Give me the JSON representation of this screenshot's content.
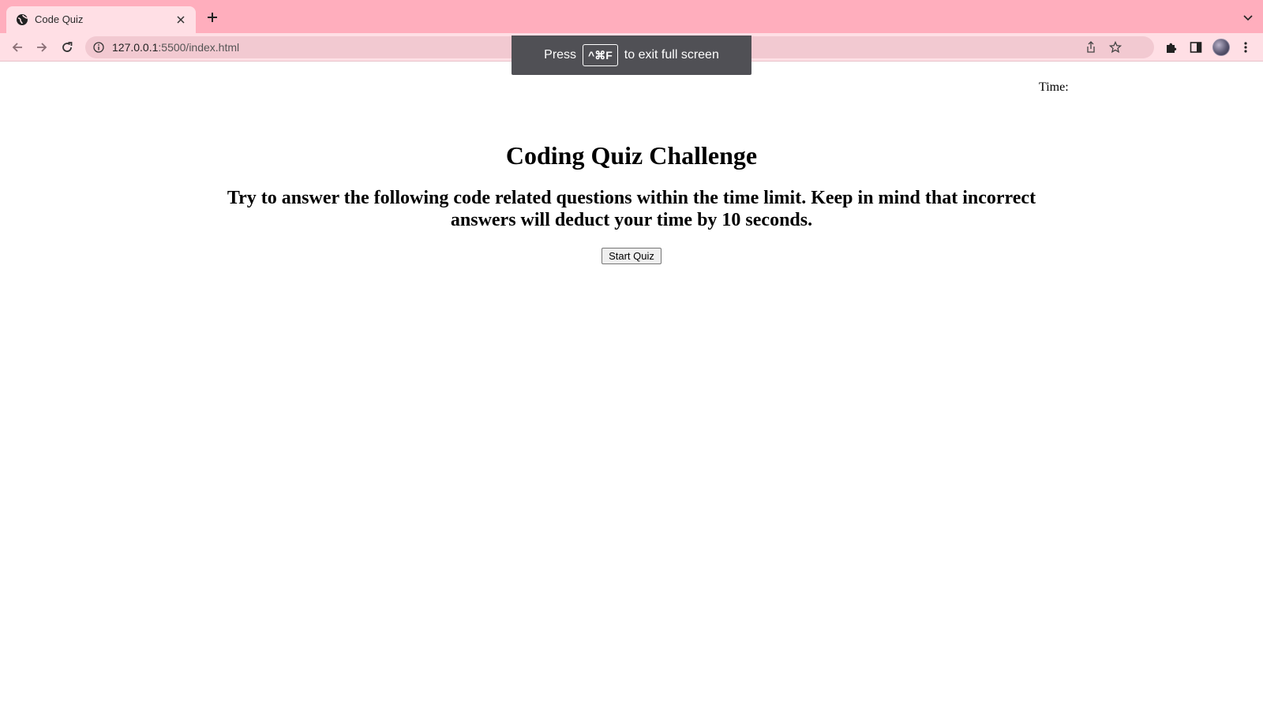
{
  "browser": {
    "tab": {
      "title": "Code Quiz"
    },
    "url": {
      "host": "127.0.0.1",
      "rest": ":5500/index.html"
    }
  },
  "fullscreen_toast": {
    "before": "Press",
    "key": "^⌘F",
    "after": "to exit full screen"
  },
  "page": {
    "timer_label": "Time:",
    "title": "Coding Quiz Challenge",
    "description": "Try to answer the following code related questions within the time limit. Keep in mind that incorrect answers will deduct your time by 10 seconds.",
    "start_button": "Start Quiz"
  },
  "colors": {
    "tabstrip": "#ffaebd",
    "toolbar": "#ffdfe5",
    "omnibox": "#f2c9d1",
    "toast": "#505055"
  }
}
